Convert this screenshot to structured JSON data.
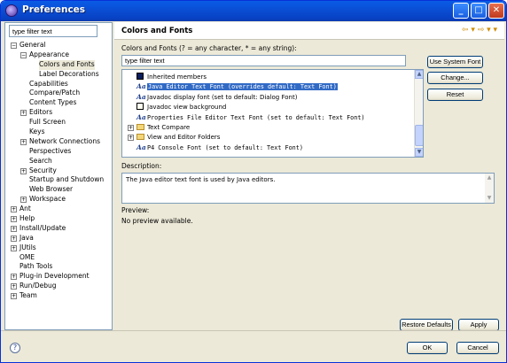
{
  "window": {
    "title": "Preferences"
  },
  "left": {
    "filter_placeholder": "type filter text",
    "tree": [
      {
        "label": "General",
        "depth": 0,
        "expander": "−"
      },
      {
        "label": "Appearance",
        "depth": 1,
        "expander": "−"
      },
      {
        "label": "Colors and Fonts",
        "depth": 2,
        "expander": "",
        "selected": true
      },
      {
        "label": "Label Decorations",
        "depth": 2,
        "expander": ""
      },
      {
        "label": "Capabilities",
        "depth": 1,
        "expander": ""
      },
      {
        "label": "Compare/Patch",
        "depth": 1,
        "expander": ""
      },
      {
        "label": "Content Types",
        "depth": 1,
        "expander": ""
      },
      {
        "label": "Editors",
        "depth": 1,
        "expander": "+"
      },
      {
        "label": "Full Screen",
        "depth": 1,
        "expander": ""
      },
      {
        "label": "Keys",
        "depth": 1,
        "expander": ""
      },
      {
        "label": "Network Connections",
        "depth": 1,
        "expander": "+"
      },
      {
        "label": "Perspectives",
        "depth": 1,
        "expander": ""
      },
      {
        "label": "Search",
        "depth": 1,
        "expander": ""
      },
      {
        "label": "Security",
        "depth": 1,
        "expander": "+"
      },
      {
        "label": "Startup and Shutdown",
        "depth": 1,
        "expander": ""
      },
      {
        "label": "Web Browser",
        "depth": 1,
        "expander": ""
      },
      {
        "label": "Workspace",
        "depth": 1,
        "expander": "+"
      },
      {
        "label": "Ant",
        "depth": 0,
        "expander": "+"
      },
      {
        "label": "Help",
        "depth": 0,
        "expander": "+"
      },
      {
        "label": "Install/Update",
        "depth": 0,
        "expander": "+"
      },
      {
        "label": "Java",
        "depth": 0,
        "expander": "+"
      },
      {
        "label": "JUtils",
        "depth": 0,
        "expander": "+"
      },
      {
        "label": "OME",
        "depth": 0,
        "expander": ""
      },
      {
        "label": "Path Tools",
        "depth": 0,
        "expander": ""
      },
      {
        "label": "Plug-in Development",
        "depth": 0,
        "expander": "+"
      },
      {
        "label": "Run/Debug",
        "depth": 0,
        "expander": "+"
      },
      {
        "label": "Team",
        "depth": 0,
        "expander": "+"
      }
    ]
  },
  "main": {
    "title": "Colors and Fonts",
    "list_caption": "Colors and Fonts (? = any character, * = any string):",
    "filter_placeholder": "type filter text",
    "font_items": [
      {
        "kind": "color",
        "swatch": "#0a1e5e",
        "label": "Inherited members"
      },
      {
        "kind": "font",
        "label": "Java Editor Text Font (overrides default: Text Font)",
        "selected": true,
        "mono": true
      },
      {
        "kind": "font",
        "label": "Javadoc display font (set to default: Dialog Font)"
      },
      {
        "kind": "color",
        "swatch": "#fffff0",
        "label": "Javadoc view background"
      },
      {
        "kind": "font",
        "label": "Properties File Editor Text Font (set to default: Text Font)",
        "mono": true
      },
      {
        "kind": "folder",
        "label": "Text Compare"
      },
      {
        "kind": "folder",
        "label": "View and Editor Folders"
      },
      {
        "kind": "font",
        "label": "P4 Console Font (set to default: Text Font)",
        "mono": true
      }
    ],
    "buttons": {
      "use_system_font": "Use System Font",
      "change": "Change...",
      "reset": "Reset"
    },
    "description_label": "Description:",
    "description_text": "The Java editor text font is used by Java editors.",
    "preview_label": "Preview:",
    "preview_text": "No preview available.",
    "restore_defaults": "Restore Defaults",
    "apply": "Apply"
  },
  "footer": {
    "ok": "OK",
    "cancel": "Cancel"
  }
}
